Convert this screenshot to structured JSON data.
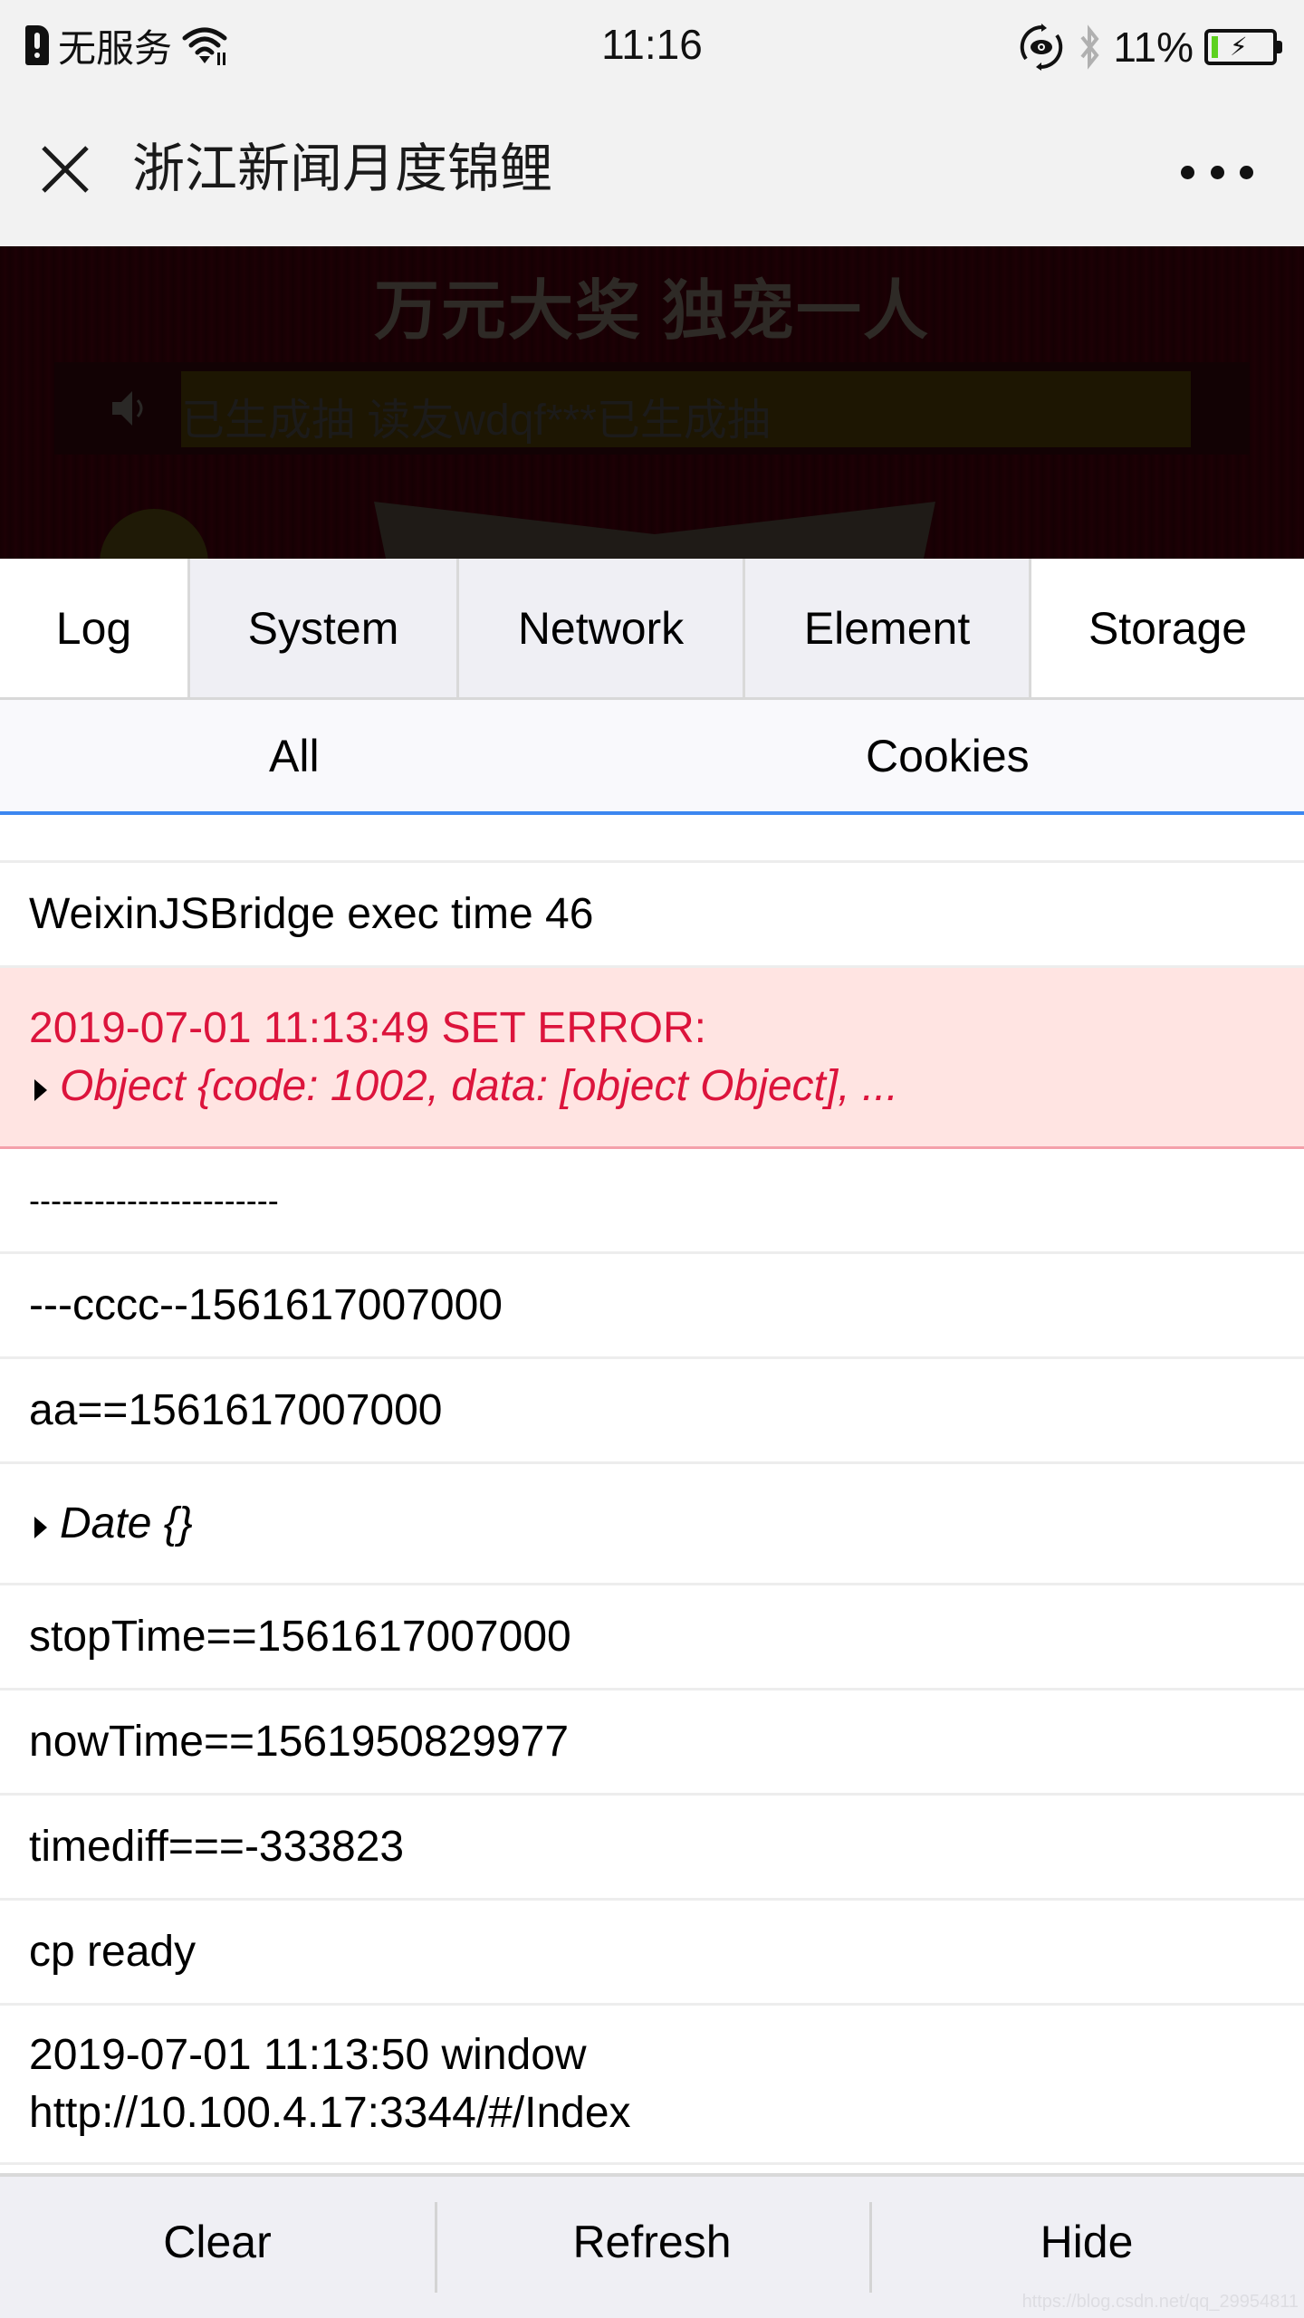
{
  "status_bar": {
    "carrier": "无服务",
    "time": "11:16",
    "battery_percent": "11%",
    "battery_level": 0.11,
    "icons": [
      "sim-alert-icon",
      "wifi-icon",
      "eye-rotate-icon",
      "bluetooth-icon",
      "battery-charging-icon"
    ]
  },
  "nav": {
    "title": "浙江新闻月度锦鲤",
    "close_icon": "close-icon",
    "more_icon": "more-icon"
  },
  "page_backdrop": {
    "banner_title": "万元大奖 独宠一人",
    "marquee_text": "已生成抽      读友wdqf***已生成抽"
  },
  "tabs": [
    {
      "label": "Log",
      "active": true
    },
    {
      "label": "System",
      "active": false
    },
    {
      "label": "Network",
      "active": false
    },
    {
      "label": "Element",
      "active": false
    },
    {
      "label": "Storage",
      "active": true
    }
  ],
  "sub_tabs": [
    {
      "label": "All"
    },
    {
      "label": "Cookies"
    }
  ],
  "logs": [
    {
      "type": "log",
      "text": ""
    },
    {
      "type": "log",
      "text": "WeixinJSBridge exec time 46"
    },
    {
      "type": "error",
      "text": "2019-07-01 11:13:49 SET ERROR:",
      "object": "Object {code: 1002, data: [object Object], ..."
    },
    {
      "type": "log",
      "text": "-----------------------"
    },
    {
      "type": "log",
      "text": "---cccc--1561617007000"
    },
    {
      "type": "log",
      "text": "aa==1561617007000"
    },
    {
      "type": "object",
      "object": "Date {}"
    },
    {
      "type": "log",
      "text": "stopTime==1561617007000"
    },
    {
      "type": "log",
      "text": "nowTime==1561950829977"
    },
    {
      "type": "log",
      "text": "timediff===-333823"
    },
    {
      "type": "log",
      "text": "cp ready"
    },
    {
      "type": "log",
      "text": "2019-07-01 11:13:50 window",
      "text2": "http://10.100.4.17:3344/#/Index"
    }
  ],
  "toolbar": {
    "clear_label": "Clear",
    "refresh_label": "Refresh",
    "hide_label": "Hide"
  },
  "watermark": "https://blog.csdn.net/qq_29954811",
  "colors": {
    "active_subtab_border": "#3c87f0",
    "error_text": "#dc143c",
    "error_bg": "#ffe4e2",
    "error_border": "#f4a0aa",
    "battery_fill": "#5ed11f"
  }
}
